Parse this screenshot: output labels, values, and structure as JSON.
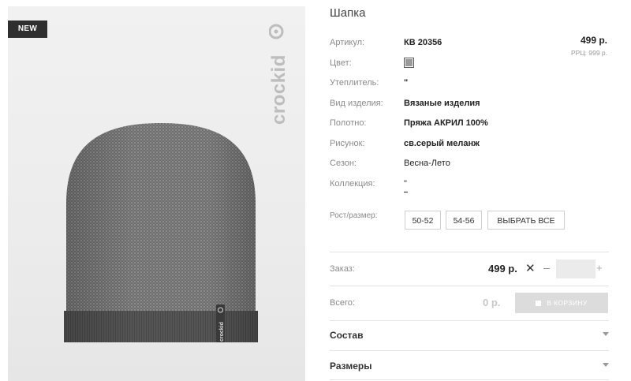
{
  "product": {
    "badge": "NEW",
    "brand": "crockid",
    "title": "Шапка",
    "price": "499 р.",
    "rrp": "РРЦ: 999 р."
  },
  "specs": [
    {
      "label": "Артикул:",
      "value": "КВ 20356"
    },
    {
      "label": "Цвет:",
      "value": ""
    },
    {
      "label": "Утеплитель:",
      "value": "\""
    },
    {
      "label": "Вид изделия:",
      "value": "Вязаные изделия"
    },
    {
      "label": "Полотно:",
      "value": "Пряжа АКРИЛ 100%"
    },
    {
      "label": "Рисунок:",
      "value": "св.серый меланж"
    },
    {
      "label": "Сезон:",
      "value": "Весна-Лето"
    },
    {
      "label": "Коллекция:",
      "value": "\""
    }
  ],
  "sizes": {
    "label": "Рост/размер:",
    "options": [
      "50-52",
      "54-56"
    ],
    "select_all": "ВЫБРАТЬ ВСЕ"
  },
  "order": {
    "label": "Заказ:",
    "price": "499 р.",
    "times": "✕",
    "minus": "–",
    "plus": "+",
    "quantity": ""
  },
  "total": {
    "label": "Всего:",
    "value": "0 р.",
    "cart_button": "В КОРЗИНУ"
  },
  "accordions": [
    {
      "label": "Состав"
    },
    {
      "label": "Размеры"
    }
  ],
  "colors": {
    "swatch": "#9a9a9a",
    "badge_bg": "#2f2f2f",
    "cart_disabled": "#dcdcdc"
  }
}
